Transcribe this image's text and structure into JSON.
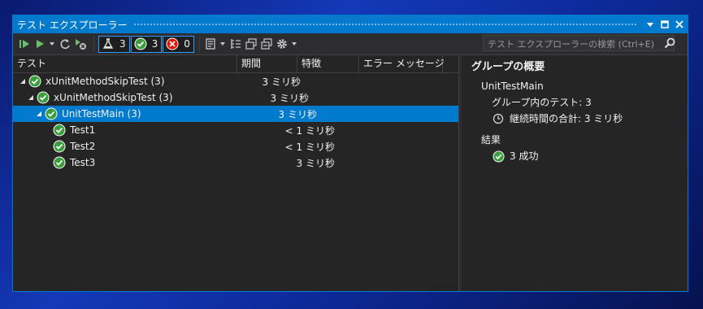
{
  "window": {
    "title": "テスト エクスプローラー"
  },
  "toolbar": {
    "counts": {
      "total": "3",
      "passed": "3",
      "failed": "0"
    },
    "search_placeholder": "テスト エクスプローラーの検索 (Ctrl+E)"
  },
  "columns": {
    "test": "テスト",
    "duration": "期間",
    "traits": "特徴",
    "error": "エラー メッセージ"
  },
  "tree": [
    {
      "label": "xUnitMethodSkipTest (3)",
      "duration": "3 ミリ秒"
    },
    {
      "label": "xUnitMethodSkipTest (3)",
      "duration": "3 ミリ秒"
    },
    {
      "label": "UnitTestMain (3)",
      "duration": "3 ミリ秒"
    },
    {
      "label": "Test1",
      "duration": "< 1 ミリ秒"
    },
    {
      "label": "Test2",
      "duration": "< 1 ミリ秒"
    },
    {
      "label": "Test3",
      "duration": "3 ミリ秒"
    }
  ],
  "summary": {
    "title": "グループの概要",
    "group_name": "UnitTestMain",
    "tests_in_group": "グループ内のテスト: 3",
    "total_duration": "継続時間の合計: 3 ミリ秒",
    "results_heading": "結果",
    "passed": "3 成功"
  },
  "colors": {
    "accent": "#007acc",
    "pass": "#3c9d3c",
    "fail": "#e51400",
    "bg": "#252526"
  }
}
